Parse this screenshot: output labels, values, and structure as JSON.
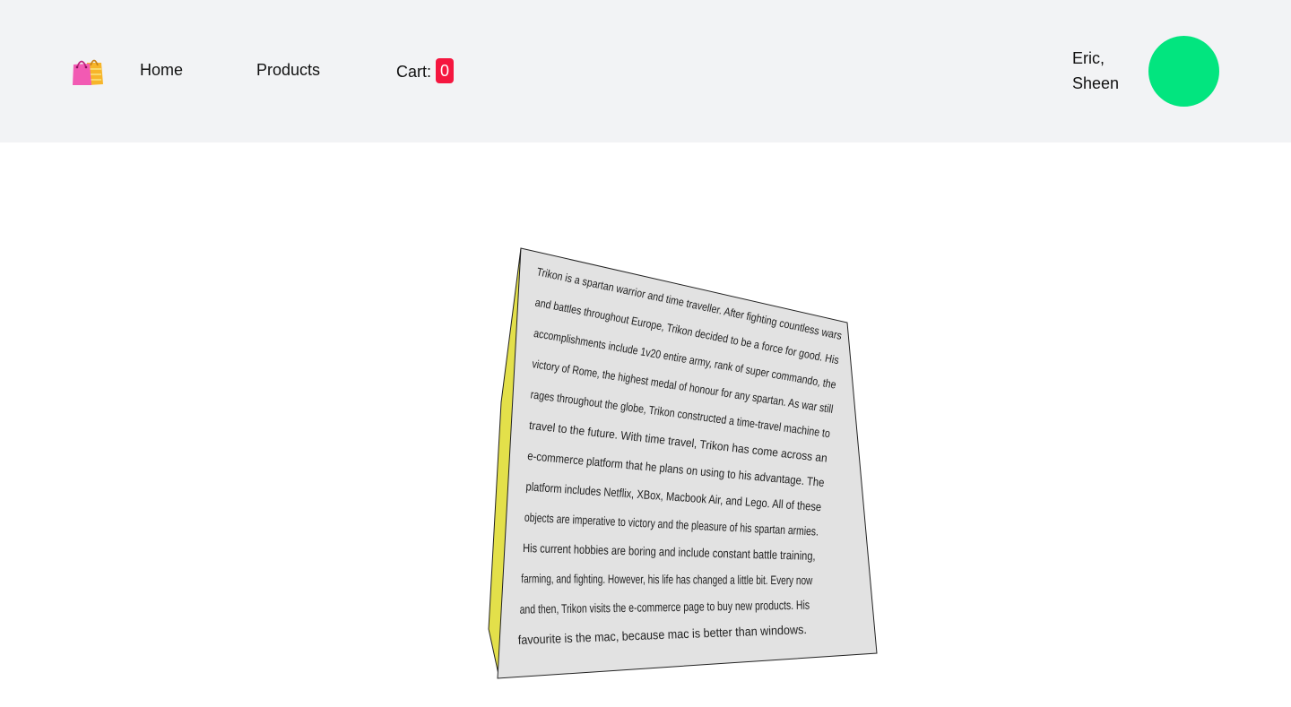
{
  "header": {
    "logo_icon": "shopping-bags-icon",
    "nav": {
      "home": "Home",
      "products": "Products",
      "cart_label": "Cart:",
      "cart_count": "0"
    },
    "user": {
      "first_name": "Eric,",
      "last_name": "Sheen",
      "avatar_color": "#02e57f"
    }
  },
  "card": {
    "side_color": "#e3e04a",
    "face_color": "#e2e2e2",
    "lines": [
      "Trikon is a spartan warrior and time traveller. After fighting countless wars",
      "and battles throughout Europe, Trikon decided to be a force for good. His",
      "accomplishments include 1v20 entire army, rank of super commando, the",
      "victory of Rome, the highest medal of honour for any spartan. As war still",
      "rages throughout the globe, Trikon constructed a time-travel machine to",
      "travel to the future. With time travel, Trikon has come across an",
      "e-commerce platform that he plans on using to his advantage. The",
      "platform includes Netflix, XBox, Macbook Air, and Lego. All of these",
      "objects are imperative to victory and the pleasure of his spartan armies.",
      "His current hobbies are boring and include constant battle training,",
      "farming, and fighting. However, his life has changed a little bit. Every now",
      "and then, Trikon visits the e-commerce page to buy new products. His",
      "favourite is the mac, because mac is better than windows."
    ]
  }
}
